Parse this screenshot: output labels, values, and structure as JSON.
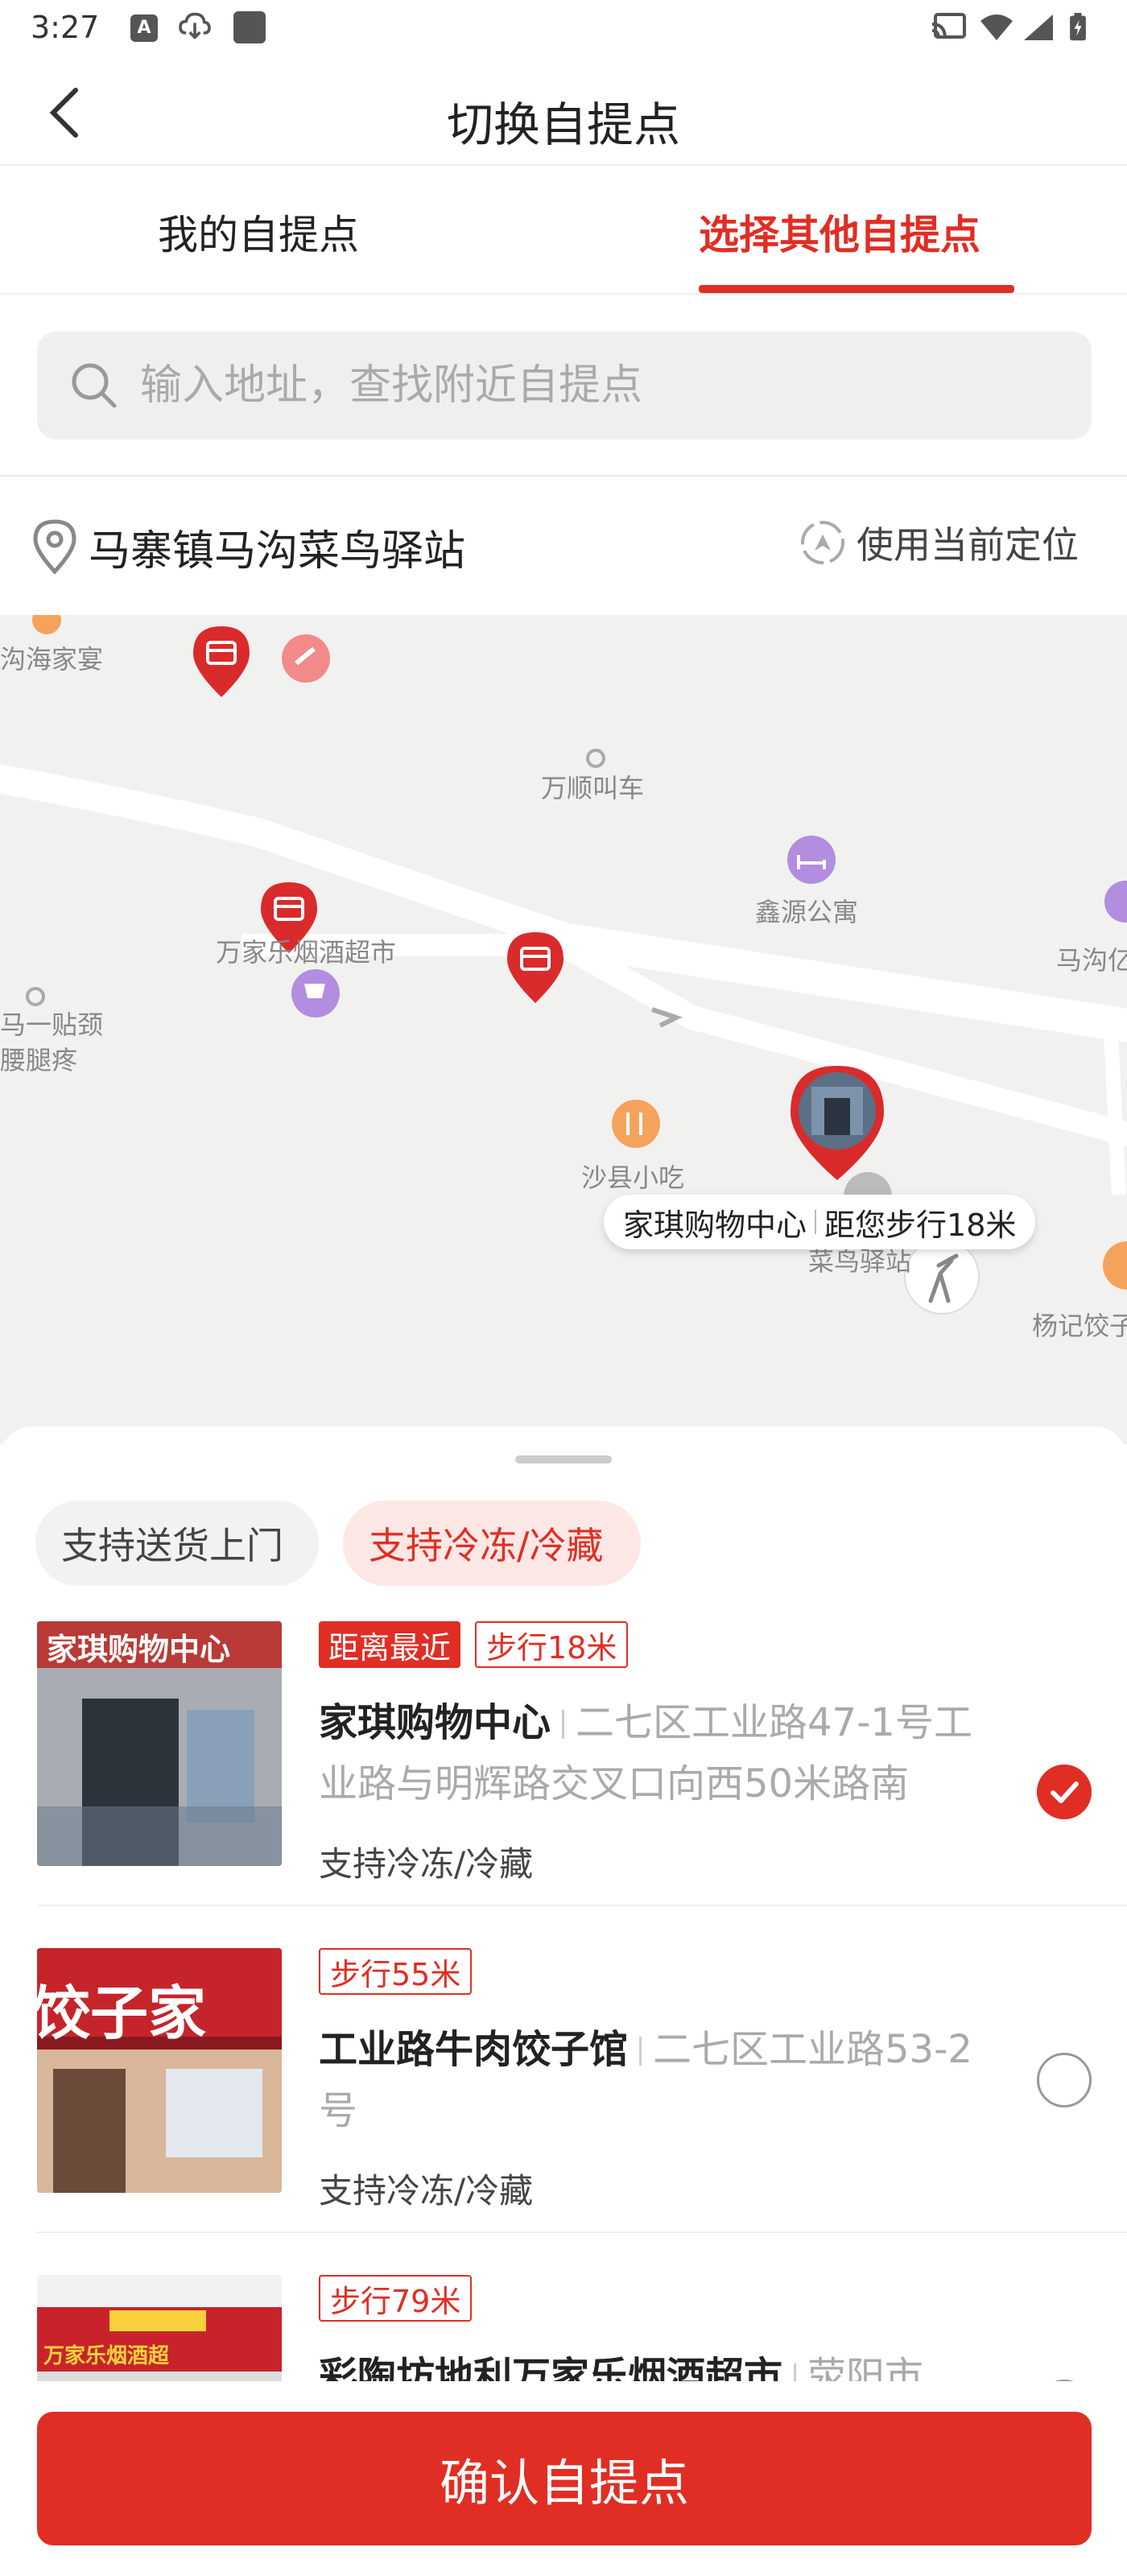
{
  "status_bar": {
    "time": "3:27",
    "left_icons": [
      "a-icon",
      "cloud-download-icon",
      "app-icon"
    ],
    "right_icons": [
      "cast-icon",
      "wifi-icon",
      "signal-icon",
      "battery-charging-icon"
    ]
  },
  "header": {
    "back_icon": "chevron-left-icon",
    "title": "切换自提点"
  },
  "tabs": [
    {
      "label": "我的自提点",
      "active": false
    },
    {
      "label": "选择其他自提点",
      "active": true
    }
  ],
  "search": {
    "placeholder": "输入地址，查找附近自提点",
    "value": ""
  },
  "location": {
    "current_name": "马寨镇马沟菜鸟驿站",
    "use_current_label": "使用当前定位"
  },
  "map": {
    "labels": [
      "沟海家宴",
      "万顺叫车",
      "鑫源公寓",
      "马沟亿",
      "万家乐烟酒超市",
      "马一贴颈",
      "腰腿疼",
      "沙县小吃",
      "菜鸟驿站",
      "杨记饺子"
    ],
    "callout": {
      "name": "家琪购物中心",
      "distance": "距您步行18米"
    }
  },
  "filters": [
    {
      "label": "支持送货上门",
      "active": false
    },
    {
      "label": "支持冷冻/冷藏",
      "active": true
    }
  ],
  "stores": [
    {
      "badges": [
        {
          "text": "距离最近",
          "style": "solid"
        },
        {
          "text": "步行18米",
          "style": "outline"
        }
      ],
      "name": "家琪购物中心",
      "address": "二七区工业路47-1号工业路与明辉路交叉口向西50米路南",
      "support": "支持冷冻/冷藏",
      "selected": true,
      "sign_text": "家琪购物中心"
    },
    {
      "badges": [
        {
          "text": "步行55米",
          "style": "outline"
        }
      ],
      "name": "工业路牛肉饺子馆",
      "address": "二七区工业路53-2号",
      "support": "支持冷冻/冷藏",
      "selected": false,
      "sign_text": "饺子家"
    },
    {
      "badges": [
        {
          "text": "步行79米",
          "style": "outline"
        }
      ],
      "name": "彩陶坊地利万家乐烟酒超市",
      "address": "荥阳市",
      "support": "",
      "selected": false,
      "sign_text": "万家乐烟酒超"
    }
  ],
  "confirm_label": "确认自提点",
  "colors": {
    "accent": "#e02e24",
    "map_bg": "#f1f1ef"
  }
}
